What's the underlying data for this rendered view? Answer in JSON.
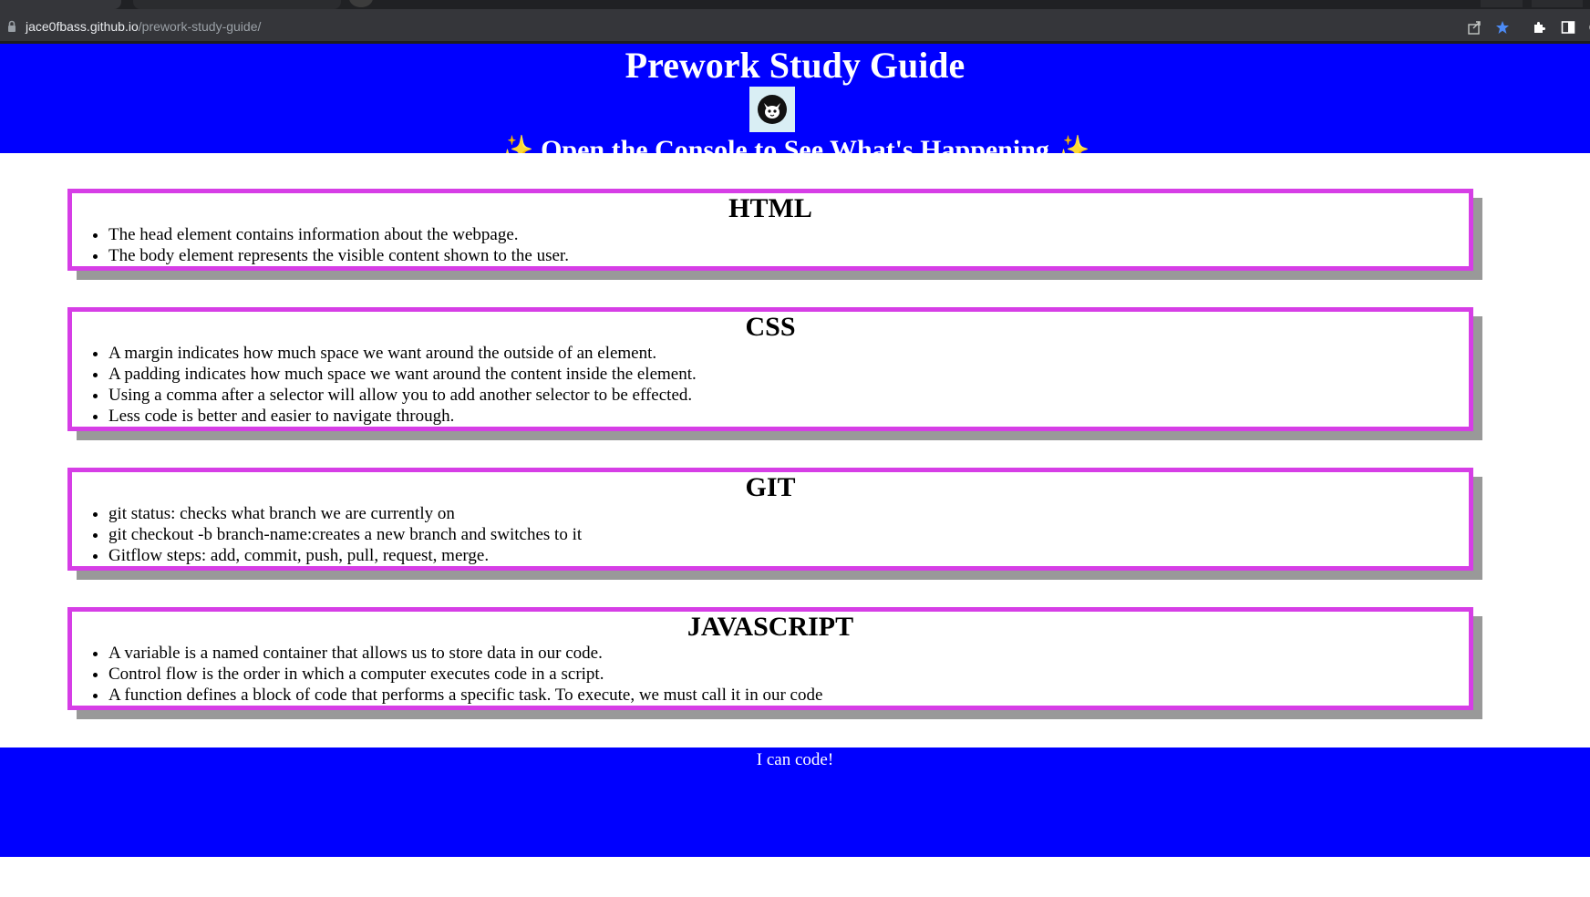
{
  "browser": {
    "url_host": "jace0fbass.github.io",
    "url_path": "/prework-study-guide/",
    "icons": [
      "lock-icon",
      "share-icon",
      "bookmark-star-icon",
      "extensions-icon",
      "side-panel-icon"
    ],
    "bookmark_color": "#4c8bf5"
  },
  "header": {
    "title": "Prework Study Guide",
    "logo_icon": "cat-logo-icon",
    "subtitle": "Open the Console to See What's Happening",
    "sparkle_left": "✨",
    "sparkle_right": "✨",
    "background_color": "#0000ff"
  },
  "sections": [
    {
      "title": "HTML",
      "items": [
        "The head element contains information about the webpage.",
        "The body element represents the visible content shown to the user."
      ]
    },
    {
      "title": "CSS",
      "items": [
        "A margin indicates how much space we want around the outside of an element.",
        "A padding indicates how much space we want around the content inside the element.",
        "Using a comma after a selector will allow you to add another selector to be effected.",
        "Less code is better and easier to navigate through."
      ]
    },
    {
      "title": "GIT",
      "items": [
        "git status: checks what branch we are currently on",
        "git checkout -b branch-name:creates a new branch and switches to it",
        "Gitflow steps: add, commit, push, pull, request, merge."
      ]
    },
    {
      "title": "JAVASCRIPT",
      "items": [
        "A variable is a named container that allows us to store data in our code.",
        "Control flow is the order in which a computer executes code in a script.",
        "A function defines a block of code that performs a specific task. To execute, we must call it in our code"
      ]
    }
  ],
  "footer": {
    "text": "I can code!"
  },
  "colors": {
    "card_border": "#d63ee6",
    "card_shadow": "#999999"
  }
}
